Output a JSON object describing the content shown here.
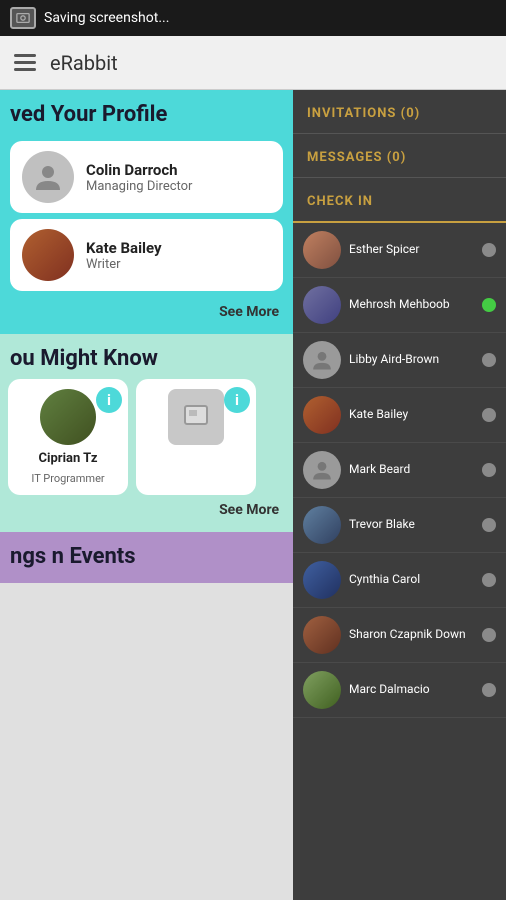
{
  "statusBar": {
    "text": "Saving screenshot..."
  },
  "header": {
    "title": "eRabbit"
  },
  "leftPanel": {
    "sections": [
      {
        "id": "viewed-profile",
        "title": "ved Your Profile",
        "bgColor": "#4dd9d9",
        "people": [
          {
            "name": "Colin Darroch",
            "role": "Managing Director",
            "hasPhoto": false
          },
          {
            "name": "Kate Bailey",
            "role": "Writer",
            "hasPhoto": true
          }
        ],
        "seeMore": "See More"
      },
      {
        "id": "might-know",
        "title": "ou Might Know",
        "bgColor": "#80d8c0",
        "people": [
          {
            "name": "Ciprian Tz",
            "role": "IT Programmer",
            "hasPhoto": true
          },
          {
            "name": "",
            "role": "",
            "hasPhoto": false,
            "isPlaceholder": true
          }
        ],
        "seeMore": "See More"
      },
      {
        "id": "events",
        "title": "ngs n Events",
        "bgColor": "#b090c8"
      }
    ]
  },
  "rightPanel": {
    "tabs": [
      {
        "id": "invitations",
        "label": "INVITATIONS (0)"
      },
      {
        "id": "messages",
        "label": "MESSAGES (0)"
      },
      {
        "id": "checkin",
        "label": "CHECK IN"
      }
    ],
    "checkinPeople": [
      {
        "name": "Esther Spicer",
        "online": false,
        "hasPhoto": true
      },
      {
        "name": "Mehrosh Mehboob",
        "online": true,
        "hasPhoto": true
      },
      {
        "name": "Libby Aird-Brown",
        "online": false,
        "hasPhoto": false
      },
      {
        "name": "Kate Bailey",
        "online": false,
        "hasPhoto": true
      },
      {
        "name": "Mark Beard",
        "online": false,
        "hasPhoto": false
      },
      {
        "name": "Trevor Blake",
        "online": false,
        "hasPhoto": true
      },
      {
        "name": "Cynthia Carol",
        "online": false,
        "hasPhoto": true
      },
      {
        "name": "Sharon Czapnik Down",
        "online": false,
        "hasPhoto": true
      },
      {
        "name": "Marc Dalmacio",
        "online": false,
        "hasPhoto": true
      }
    ]
  }
}
